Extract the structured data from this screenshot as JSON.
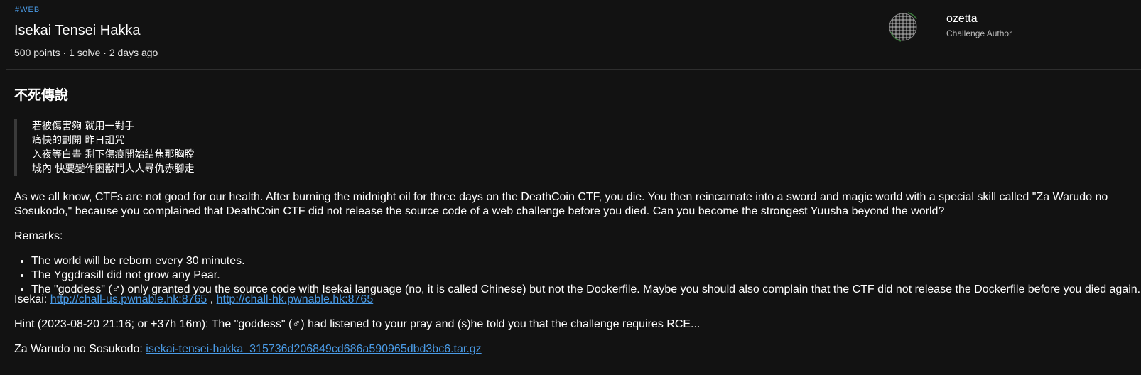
{
  "header": {
    "tag": "#WEB",
    "title": "Isekai Tensei Hakka",
    "meta": "500 points · 1 solve · 2 days ago"
  },
  "author": {
    "name": "ozetta",
    "role": "Challenge Author",
    "avatar_icon": "globe-wireframe-icon"
  },
  "content": {
    "heading": "不死傳說",
    "poem": [
      "若被傷害夠 就用一對手",
      "痛快的劃開 昨日詛咒",
      "入夜等白晝 剩下傷痕開始結焦那胸膛",
      "城內 快要變作困獸鬥人人尋仇赤腳走"
    ],
    "intro": "As we all know, CTFs are not good for our health. After burning the midnight oil for three days on the DeathCoin CTF, you die. You then reincarnate into a sword and magic world with a special skill called \"Za Warudo no Sosukodo,\" because you complained that DeathCoin CTF did not release the source code of a web challenge before you died. Can you become the strongest Yuusha beyond the world?",
    "remarks_label": "Remarks:",
    "remarks": [
      "The world will be reborn every 30 minutes.",
      "The Yggdrasill did not grow any Pear.",
      "The \"goddess\" (♂) only granted you the source code with Isekai language (no, it is called Chinese) but not the Dockerfile. Maybe you should also complain that the CTF did not release the Dockerfile before you died again."
    ],
    "isekai_label": "Isekai:",
    "isekai_links": [
      "http://chall-us.pwnable.hk:8765",
      "http://chall-hk.pwnable.hk:8765"
    ],
    "isekai_sep": " , ",
    "hint": "Hint (2023-08-20 21:16; or +37h 16m): The \"goddess\" (♂) had listened to your pray and (s)he told you that the challenge requires RCE...",
    "warudo_label": "Za Warudo no Sosukodo:",
    "warudo_file": "isekai-tensei-hakka_315736d206849cd686a590965dbd3bc6.tar.gz"
  },
  "colors": {
    "background": "#121212",
    "link": "#4a9be6",
    "divider": "#2e2e2e"
  }
}
